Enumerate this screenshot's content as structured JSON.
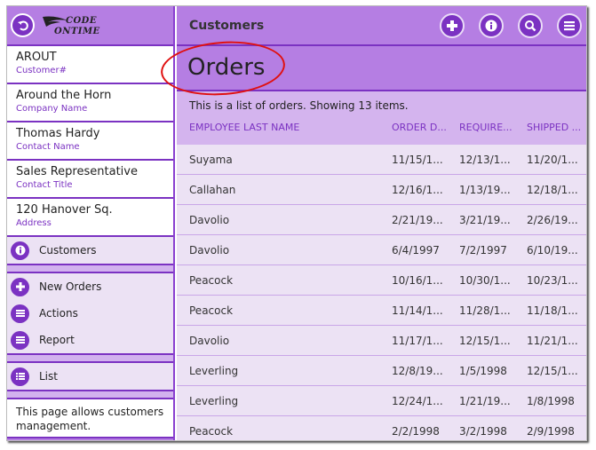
{
  "sidebar": {
    "logo": {
      "line1": "CODE",
      "line2": "ONTIME"
    },
    "fields": [
      {
        "value": "AROUT",
        "label": "Customer#"
      },
      {
        "value": "Around the Horn",
        "label": "Company Name"
      },
      {
        "value": "Thomas Hardy",
        "label": "Contact Name"
      },
      {
        "value": "Sales Representative",
        "label": "Contact Title"
      },
      {
        "value": "120 Hanover Sq.",
        "label": "Address"
      }
    ],
    "context": {
      "label": "Customers",
      "icon": "info-icon"
    },
    "actions": [
      {
        "label": "New Orders",
        "icon": "plus-icon"
      },
      {
        "label": "Actions",
        "icon": "menu-icon"
      },
      {
        "label": "Report",
        "icon": "menu-icon"
      }
    ],
    "views": [
      {
        "label": "List",
        "icon": "list-icon"
      }
    ],
    "description": "This page allows customers management."
  },
  "topbar": {
    "title": "Customers",
    "buttons": [
      "plus-icon",
      "info-icon",
      "search-icon",
      "menu-icon"
    ]
  },
  "page": {
    "heading": "Orders",
    "info": "This is a list of orders. Showing 13 items.",
    "columns": [
      "EMPLOYEE LAST NAME",
      "ORDER D...",
      "REQUIRE...",
      "SHIPPED ..."
    ],
    "rows": [
      [
        "Suyama",
        "11/15/1...",
        "12/13/1...",
        "11/20/1..."
      ],
      [
        "Callahan",
        "12/16/1...",
        "1/13/19...",
        "12/18/1..."
      ],
      [
        "Davolio",
        "2/21/19...",
        "3/21/19...",
        "2/26/19..."
      ],
      [
        "Davolio",
        "6/4/1997",
        "7/2/1997",
        "6/10/19..."
      ],
      [
        "Peacock",
        "10/16/1...",
        "10/30/1...",
        "10/23/1..."
      ],
      [
        "Peacock",
        "11/14/1...",
        "11/28/1...",
        "11/18/1..."
      ],
      [
        "Davolio",
        "11/17/1...",
        "12/15/1...",
        "11/21/1..."
      ],
      [
        "Leverling",
        "12/8/19...",
        "1/5/1998",
        "12/15/1..."
      ],
      [
        "Leverling",
        "12/24/1...",
        "1/21/19...",
        "1/8/1998"
      ],
      [
        "Peacock",
        "2/2/1998",
        "3/2/1998",
        "2/9/1998"
      ]
    ]
  }
}
